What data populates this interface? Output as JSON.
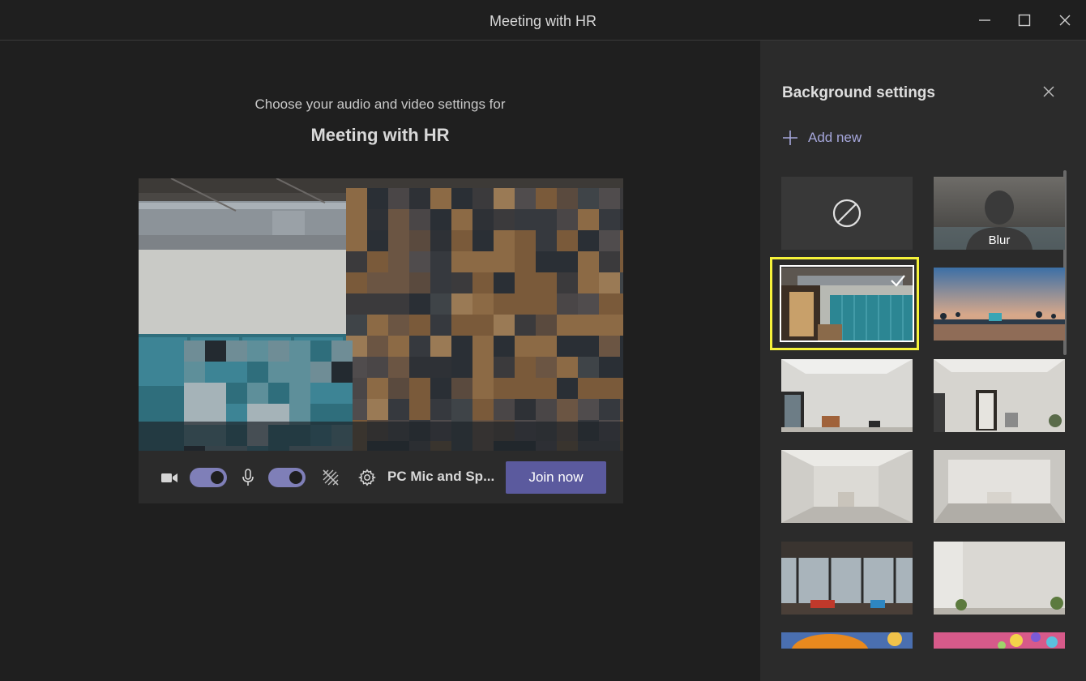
{
  "window": {
    "title": "Meeting with HR",
    "controls": [
      "minimize-icon",
      "maximize-icon",
      "close-icon"
    ]
  },
  "prejoin": {
    "prompt": "Choose your audio and video settings for",
    "meeting_name": "Meeting with HR",
    "camera_on": true,
    "mic_on": true,
    "device_label": "PC Mic and Sp...",
    "join_label": "Join now"
  },
  "background_panel": {
    "title": "Background settings",
    "add_new_label": "Add new",
    "options": [
      {
        "name": "None",
        "icon": "no-background-icon"
      },
      {
        "name": "Blur",
        "label": "Blur"
      },
      {
        "name": "Office corridor",
        "selected": true
      },
      {
        "name": "Beach lifeguard tower"
      },
      {
        "name": "White room 1"
      },
      {
        "name": "White room 2"
      },
      {
        "name": "White room 3"
      },
      {
        "name": "White room 4"
      },
      {
        "name": "Loft office"
      },
      {
        "name": "White wall plant"
      },
      {
        "name": "Orange balloon"
      },
      {
        "name": "Pink balloons"
      }
    ],
    "selected_index": 2
  },
  "colors": {
    "accent": "#5b5a9e",
    "toggle": "#7f7fb8",
    "link": "#a6a7dc",
    "highlight": "#f5f23a"
  }
}
